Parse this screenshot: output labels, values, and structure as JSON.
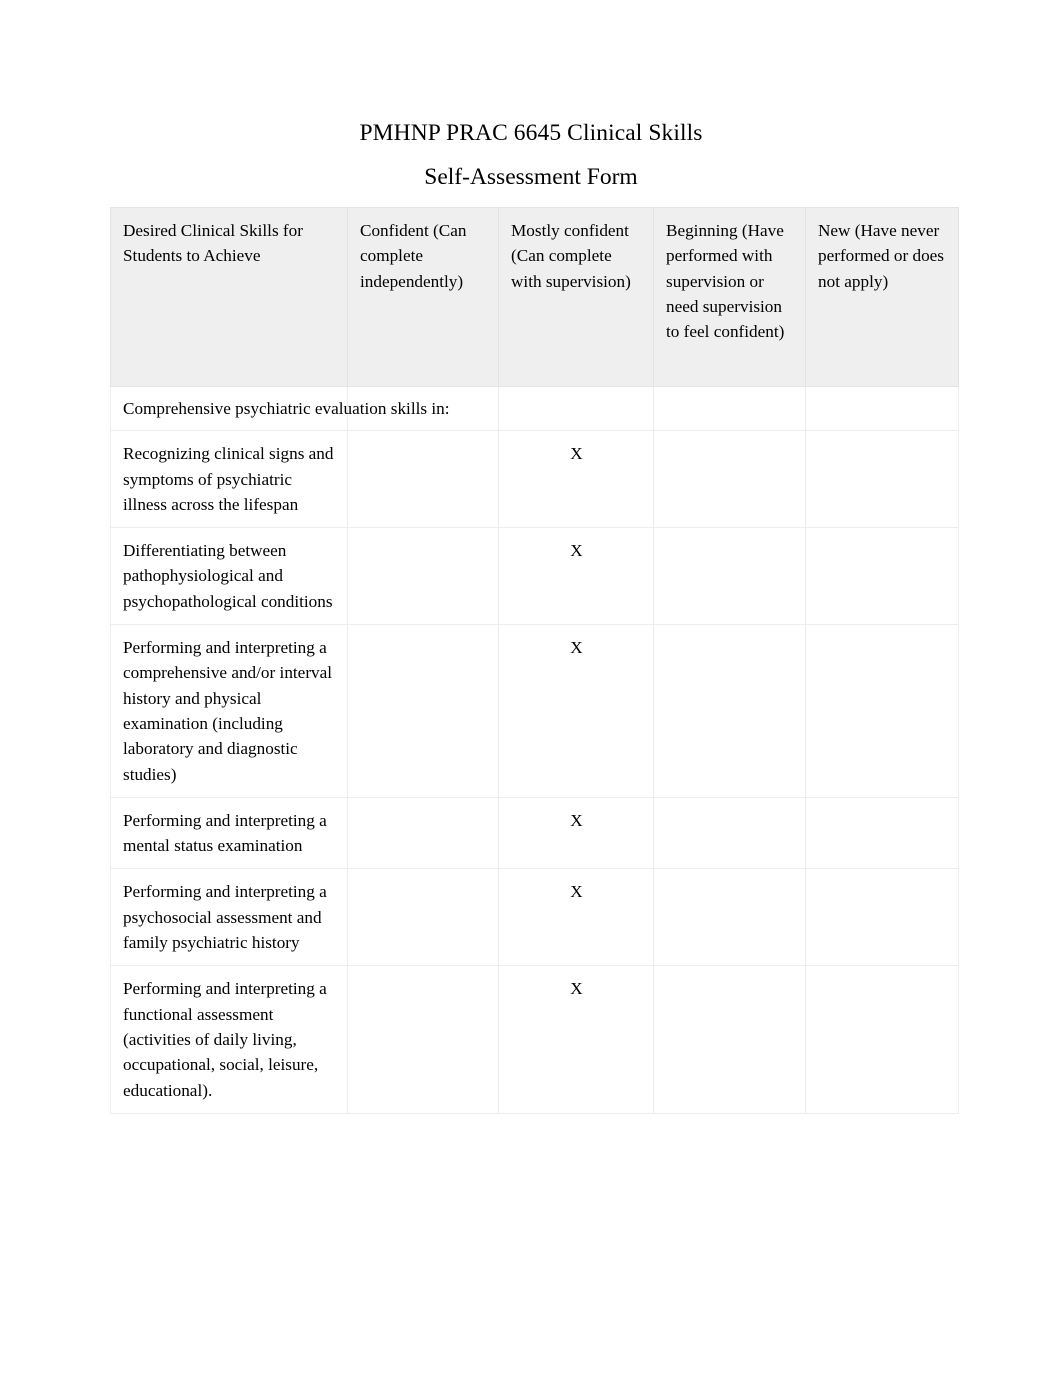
{
  "document": {
    "title_line1": "PMHNP PRAC 6645 Clinical Skills",
    "title_line2": "Self-Assessment Form"
  },
  "table": {
    "columns": [
      "Desired Clinical Skills for Students to Achieve",
      "Confident (Can complete independently)",
      "Mostly confident  (Can complete with supervision)",
      "Beginning (Have performed with supervision or need supervision to feel confident)",
      "New (Have never performed or does not apply)"
    ],
    "section_label": "Comprehensive psychiatric evaluation skills in:",
    "rows": [
      {
        "skill": "Recognizing clinical signs and symptoms of psychiatric illness across the lifespan",
        "confident": "",
        "mostly_confident": "X",
        "beginning": "",
        "new": ""
      },
      {
        "skill": "Differentiating between pathophysiological and psychopathological conditions",
        "confident": "",
        "mostly_confident": "X",
        "beginning": "",
        "new": ""
      },
      {
        "skill": "Performing and interpreting a comprehensive and/or interval history and physical examination (including laboratory and diagnostic studies)",
        "confident": "",
        "mostly_confident": "X",
        "beginning": "",
        "new": ""
      },
      {
        "skill": "Performing and interpreting a mental status examination",
        "confident": "",
        "mostly_confident": "X",
        "beginning": "",
        "new": ""
      },
      {
        "skill": "Performing and interpreting a psychosocial assessment and family psychiatric history",
        "confident": "",
        "mostly_confident": "X",
        "beginning": "",
        "new": ""
      },
      {
        "skill": "Performing and interpreting a functional assessment (activities of daily living, occupational, social, leisure, educational).",
        "confident": "",
        "mostly_confident": "X",
        "beginning": "",
        "new": ""
      }
    ]
  },
  "colors": {
    "header_background": "#efefef",
    "border": "#ededed",
    "text": "#000000",
    "page_background": "#ffffff"
  }
}
